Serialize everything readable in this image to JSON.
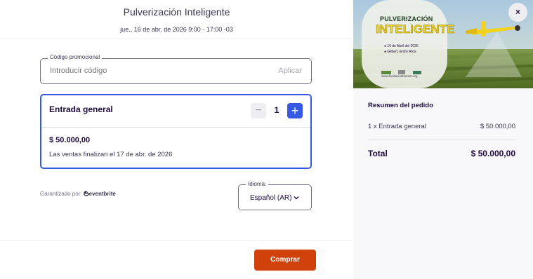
{
  "header": {
    "title": "Pulverización Inteligente",
    "datetime": "jue., 16 de abr. de 2026 9:00 - 17:00 -03"
  },
  "promo": {
    "legend": "Código promocional",
    "placeholder": "Introducir código",
    "apply_label": "Aplicar"
  },
  "ticket": {
    "name": "Entrada general",
    "minus_label": "−",
    "quantity": "1",
    "plus_label": "+",
    "price": "$ 50.000,00",
    "sales_end": "Las ventas finalizan el 17 de abr. de 2026"
  },
  "powered_by": {
    "prefix": "Garantizado por",
    "brand": "eventbrite"
  },
  "language": {
    "legend": "Idioma:",
    "value": "Español (AR)"
  },
  "footer": {
    "buy_label": "Comprar"
  },
  "banner": {
    "title_line1": "PULVERIZACIÓN",
    "title_line2": "INTELIGENTE",
    "date": "16 de Abril del 2026",
    "location": "Gilbert, Entre Ríos",
    "website": "www.fundacionbiomet.org"
  },
  "close_label": "×",
  "summary": {
    "title": "Resumen del pedido",
    "line_label": "1 x Entrada general",
    "line_amount": "$ 50.000,00",
    "total_label": "Total",
    "total_amount": "$ 50.000,00"
  },
  "colors": {
    "accent": "#3659e3",
    "buy": "#d1410c",
    "banner_yellow": "#f2d21b"
  }
}
